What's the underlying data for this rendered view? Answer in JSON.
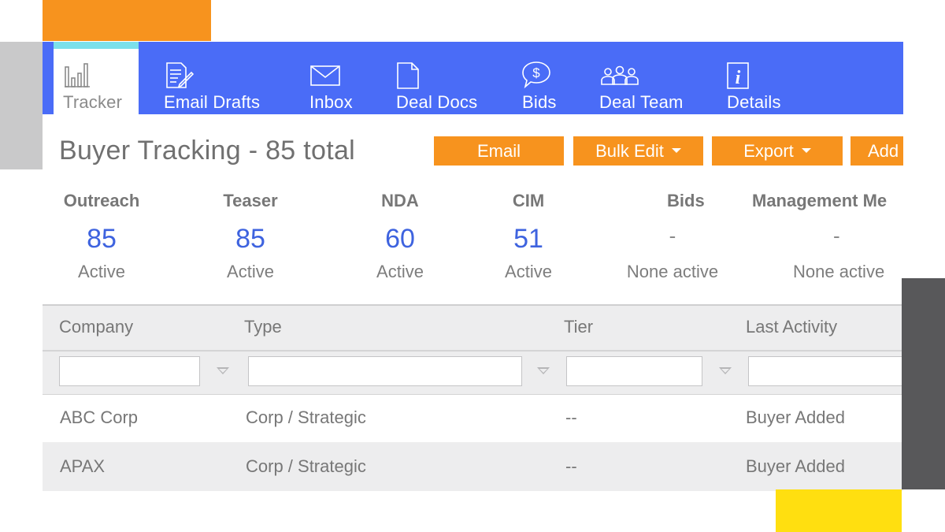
{
  "colors": {
    "nav_bg": "#4a6cf7",
    "button_bg": "#f7931e",
    "accent_value": "#3e63df",
    "active_tab_bar": "#7be0ea"
  },
  "nav": {
    "tabs": [
      {
        "label": "Tracker",
        "icon": "bar-chart-icon",
        "active": true
      },
      {
        "label": "Email Drafts",
        "icon": "document-edit-icon"
      },
      {
        "label": "Inbox",
        "icon": "envelope-icon"
      },
      {
        "label": "Deal Docs",
        "icon": "document-icon"
      },
      {
        "label": "Bids",
        "icon": "dollar-speech-bubble-icon"
      },
      {
        "label": "Deal Team",
        "icon": "group-icon"
      },
      {
        "label": "Details",
        "icon": "info-icon"
      }
    ]
  },
  "header": {
    "title": "Buyer Tracking - 85 total",
    "buttons": {
      "email": "Email",
      "bulk_edit": "Bulk Edit",
      "export": "Export",
      "add": "Add"
    }
  },
  "stats": [
    {
      "label": "Outreach",
      "value": "85",
      "status": "Active"
    },
    {
      "label": "Teaser",
      "value": "85",
      "status": "Active"
    },
    {
      "label": "NDA",
      "value": "60",
      "status": "Active"
    },
    {
      "label": "CIM",
      "value": "51",
      "status": "Active"
    },
    {
      "label": "Bids",
      "value": "-",
      "status": "None active"
    },
    {
      "label": "Management Me",
      "value": "-",
      "status": "None active"
    }
  ],
  "table": {
    "columns": [
      "Company",
      "Type",
      "Tier",
      "Last Activity"
    ],
    "filters": {
      "company": "",
      "type": "",
      "tier": "",
      "last_activity": ""
    },
    "rows": [
      {
        "company": "ABC Corp",
        "type": "Corp / Strategic",
        "tier": "--",
        "last_activity": "Buyer Added"
      },
      {
        "company": "APAX",
        "type": "Corp / Strategic",
        "tier": "--",
        "last_activity": "Buyer Added"
      }
    ]
  }
}
